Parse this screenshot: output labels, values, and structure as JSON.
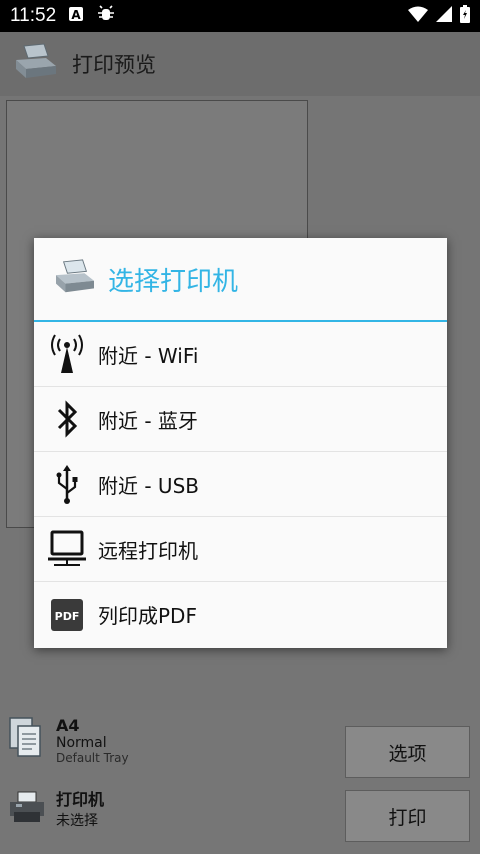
{
  "status": {
    "time": "11:52",
    "icons": [
      "a-icon",
      "bug-icon",
      "wifi-icon",
      "signal-icon",
      "battery-icon"
    ]
  },
  "appbar": {
    "title": "打印预览"
  },
  "bottom": {
    "paper": {
      "size": "A4",
      "mode": "Normal",
      "tray": "Default Tray"
    },
    "printer": {
      "label": "打印机",
      "value": "未选择"
    },
    "options_button": "选项",
    "print_button": "打印"
  },
  "dialog": {
    "title": "选择打印机",
    "accent": "#33b5e5",
    "items": [
      {
        "label": "附近 - WiFi",
        "icon": "wifi-antenna-icon"
      },
      {
        "label": "附近 - 蓝牙",
        "icon": "bluetooth-icon"
      },
      {
        "label": "附近 - USB",
        "icon": "usb-icon"
      },
      {
        "label": "远程打印机",
        "icon": "network-computer-icon"
      },
      {
        "label": "列印成PDF",
        "icon": "pdf-icon"
      }
    ]
  }
}
